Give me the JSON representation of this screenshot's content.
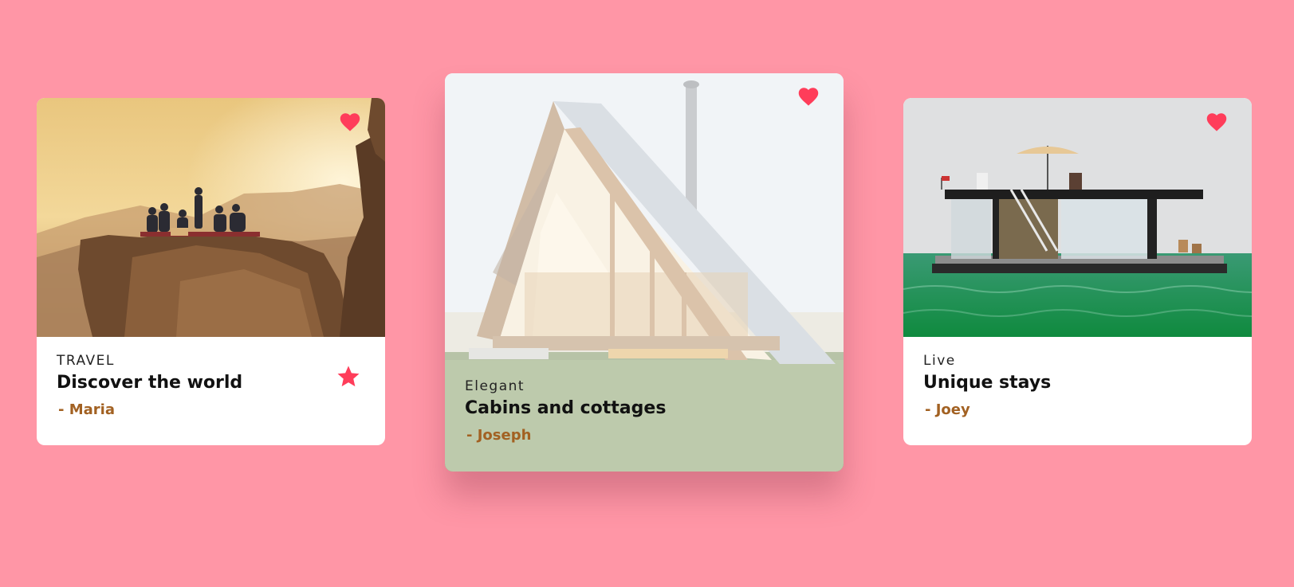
{
  "colors": {
    "background": "#ff96a6",
    "accent": "#ff3d5a",
    "author": "#a26122"
  },
  "cards": [
    {
      "kicker": "TRAVEL",
      "title": "Discover the world",
      "author": "- Maria",
      "image": "cliff-sunset-photo",
      "favorite_icon": "heart-icon",
      "rating_icon": "star-icon"
    },
    {
      "kicker": "Elegant",
      "title": "Cabins and cottages",
      "author": "- Joseph",
      "image": "a-frame-cabin-photo",
      "favorite_icon": "heart-icon"
    },
    {
      "kicker": "Live",
      "title": "Unique stays",
      "author": "- Joey",
      "image": "houseboat-photo",
      "favorite_icon": "heart-icon"
    }
  ]
}
